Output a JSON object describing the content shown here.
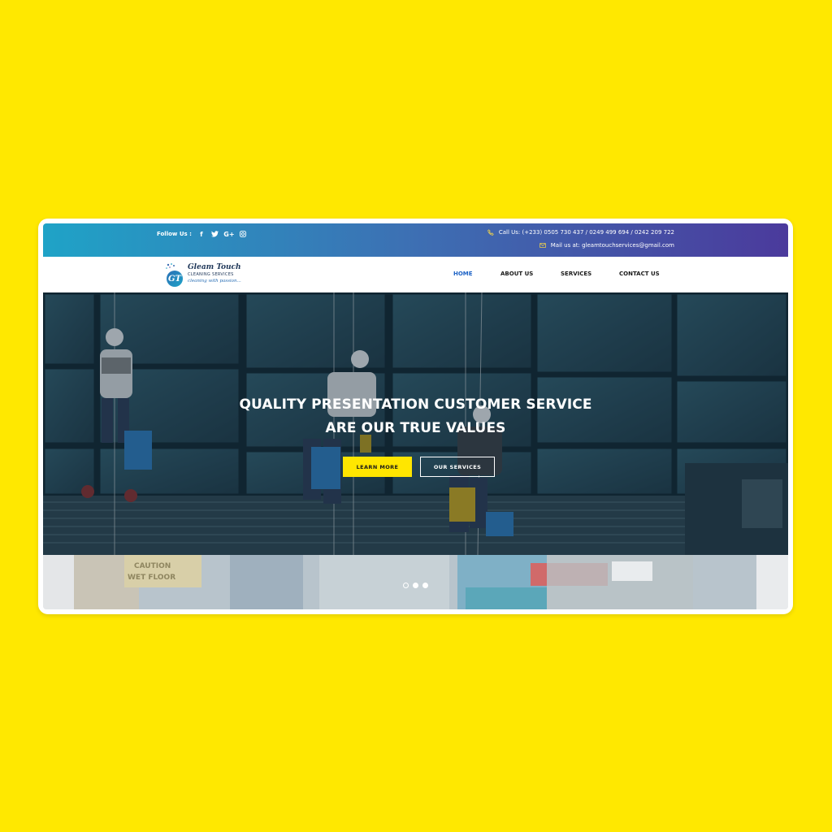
{
  "topbar": {
    "follow_label": "Follow Us :",
    "social": [
      {
        "icon": "facebook-icon",
        "glyph": "f"
      },
      {
        "icon": "twitter-icon",
        "glyph": "t"
      },
      {
        "icon": "google-plus-icon",
        "glyph": "G+"
      },
      {
        "icon": "instagram-icon",
        "glyph": "◎"
      }
    ],
    "phone": "Call Us: (+233) 0505 730 437 / 0249 499 694 / 0242 209 722",
    "mail": "Mail us at: gleamtouchservices@gmail.com"
  },
  "logo": {
    "mark": "GT",
    "name": "Gleam Touch",
    "subtitle": "CLEANING SERVICES",
    "tagline": "cleaning with passion..."
  },
  "nav": {
    "items": [
      {
        "label": "HOME",
        "active": true
      },
      {
        "label": "ABOUT US",
        "active": false
      },
      {
        "label": "SERVICES",
        "active": false
      },
      {
        "label": "CONTACT US",
        "active": false
      }
    ]
  },
  "hero": {
    "title_line1": "QUALITY PRESENTATION CUSTOMER SERVICE",
    "title_line2": "ARE OUR TRUE VALUES",
    "learn_more": "LEARN MORE",
    "our_services": "OUR SERVICES"
  },
  "strip": {
    "sign_text_1": "CAUTION",
    "sign_text_2": "WET FLOOR"
  },
  "carousel": {
    "count": 3,
    "active_index": 0
  },
  "colors": {
    "page_bg": "#FFE800",
    "topbar_start": "#1fa3c7",
    "topbar_end": "#4b3a9c",
    "accent": "#FFE600",
    "nav_active": "#1e63c6"
  }
}
